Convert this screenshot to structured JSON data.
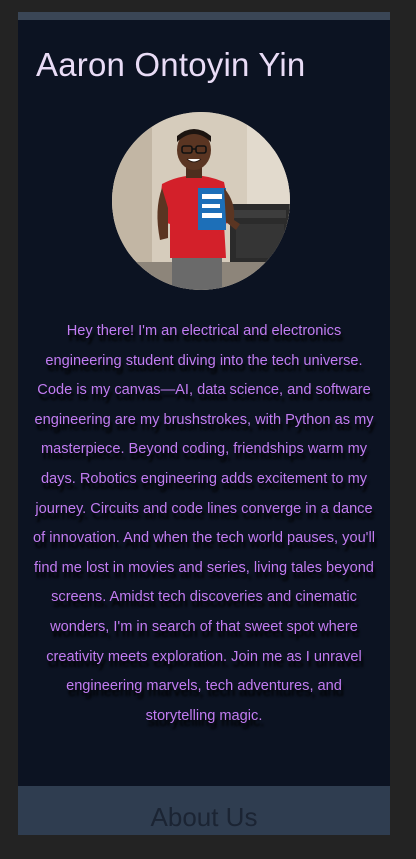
{
  "profile": {
    "name": "Aaron Ontoyin Yin",
    "bio": "Hey there! I'm an electrical and electronics engineering student diving into the tech universe. Code is my canvas—AI, data science, and software engineering are my brushstrokes, with Python as my masterpiece. Beyond coding, friendships warm my days. Robotics engineering adds excitement to my journey. Circuits and code lines converge in a dance of innovation. And when the tech world pauses, you'll find me lost in movies and series, living tales beyond screens. Amidst tech discoveries and cinematic wonders, I'm in search of that sweet spot where creativity meets exploration. Join me as I unravel engineering marvels, tech adventures, and storytelling magic."
  },
  "sections": {
    "about_title": "About Us"
  },
  "colors": {
    "page_background": "#232323",
    "card_background": "#0c1322",
    "name_text": "#e9dcf6",
    "bio_text": "#c27cf2",
    "about_bar": "#2f3d50",
    "shirt": "#d3202a"
  }
}
